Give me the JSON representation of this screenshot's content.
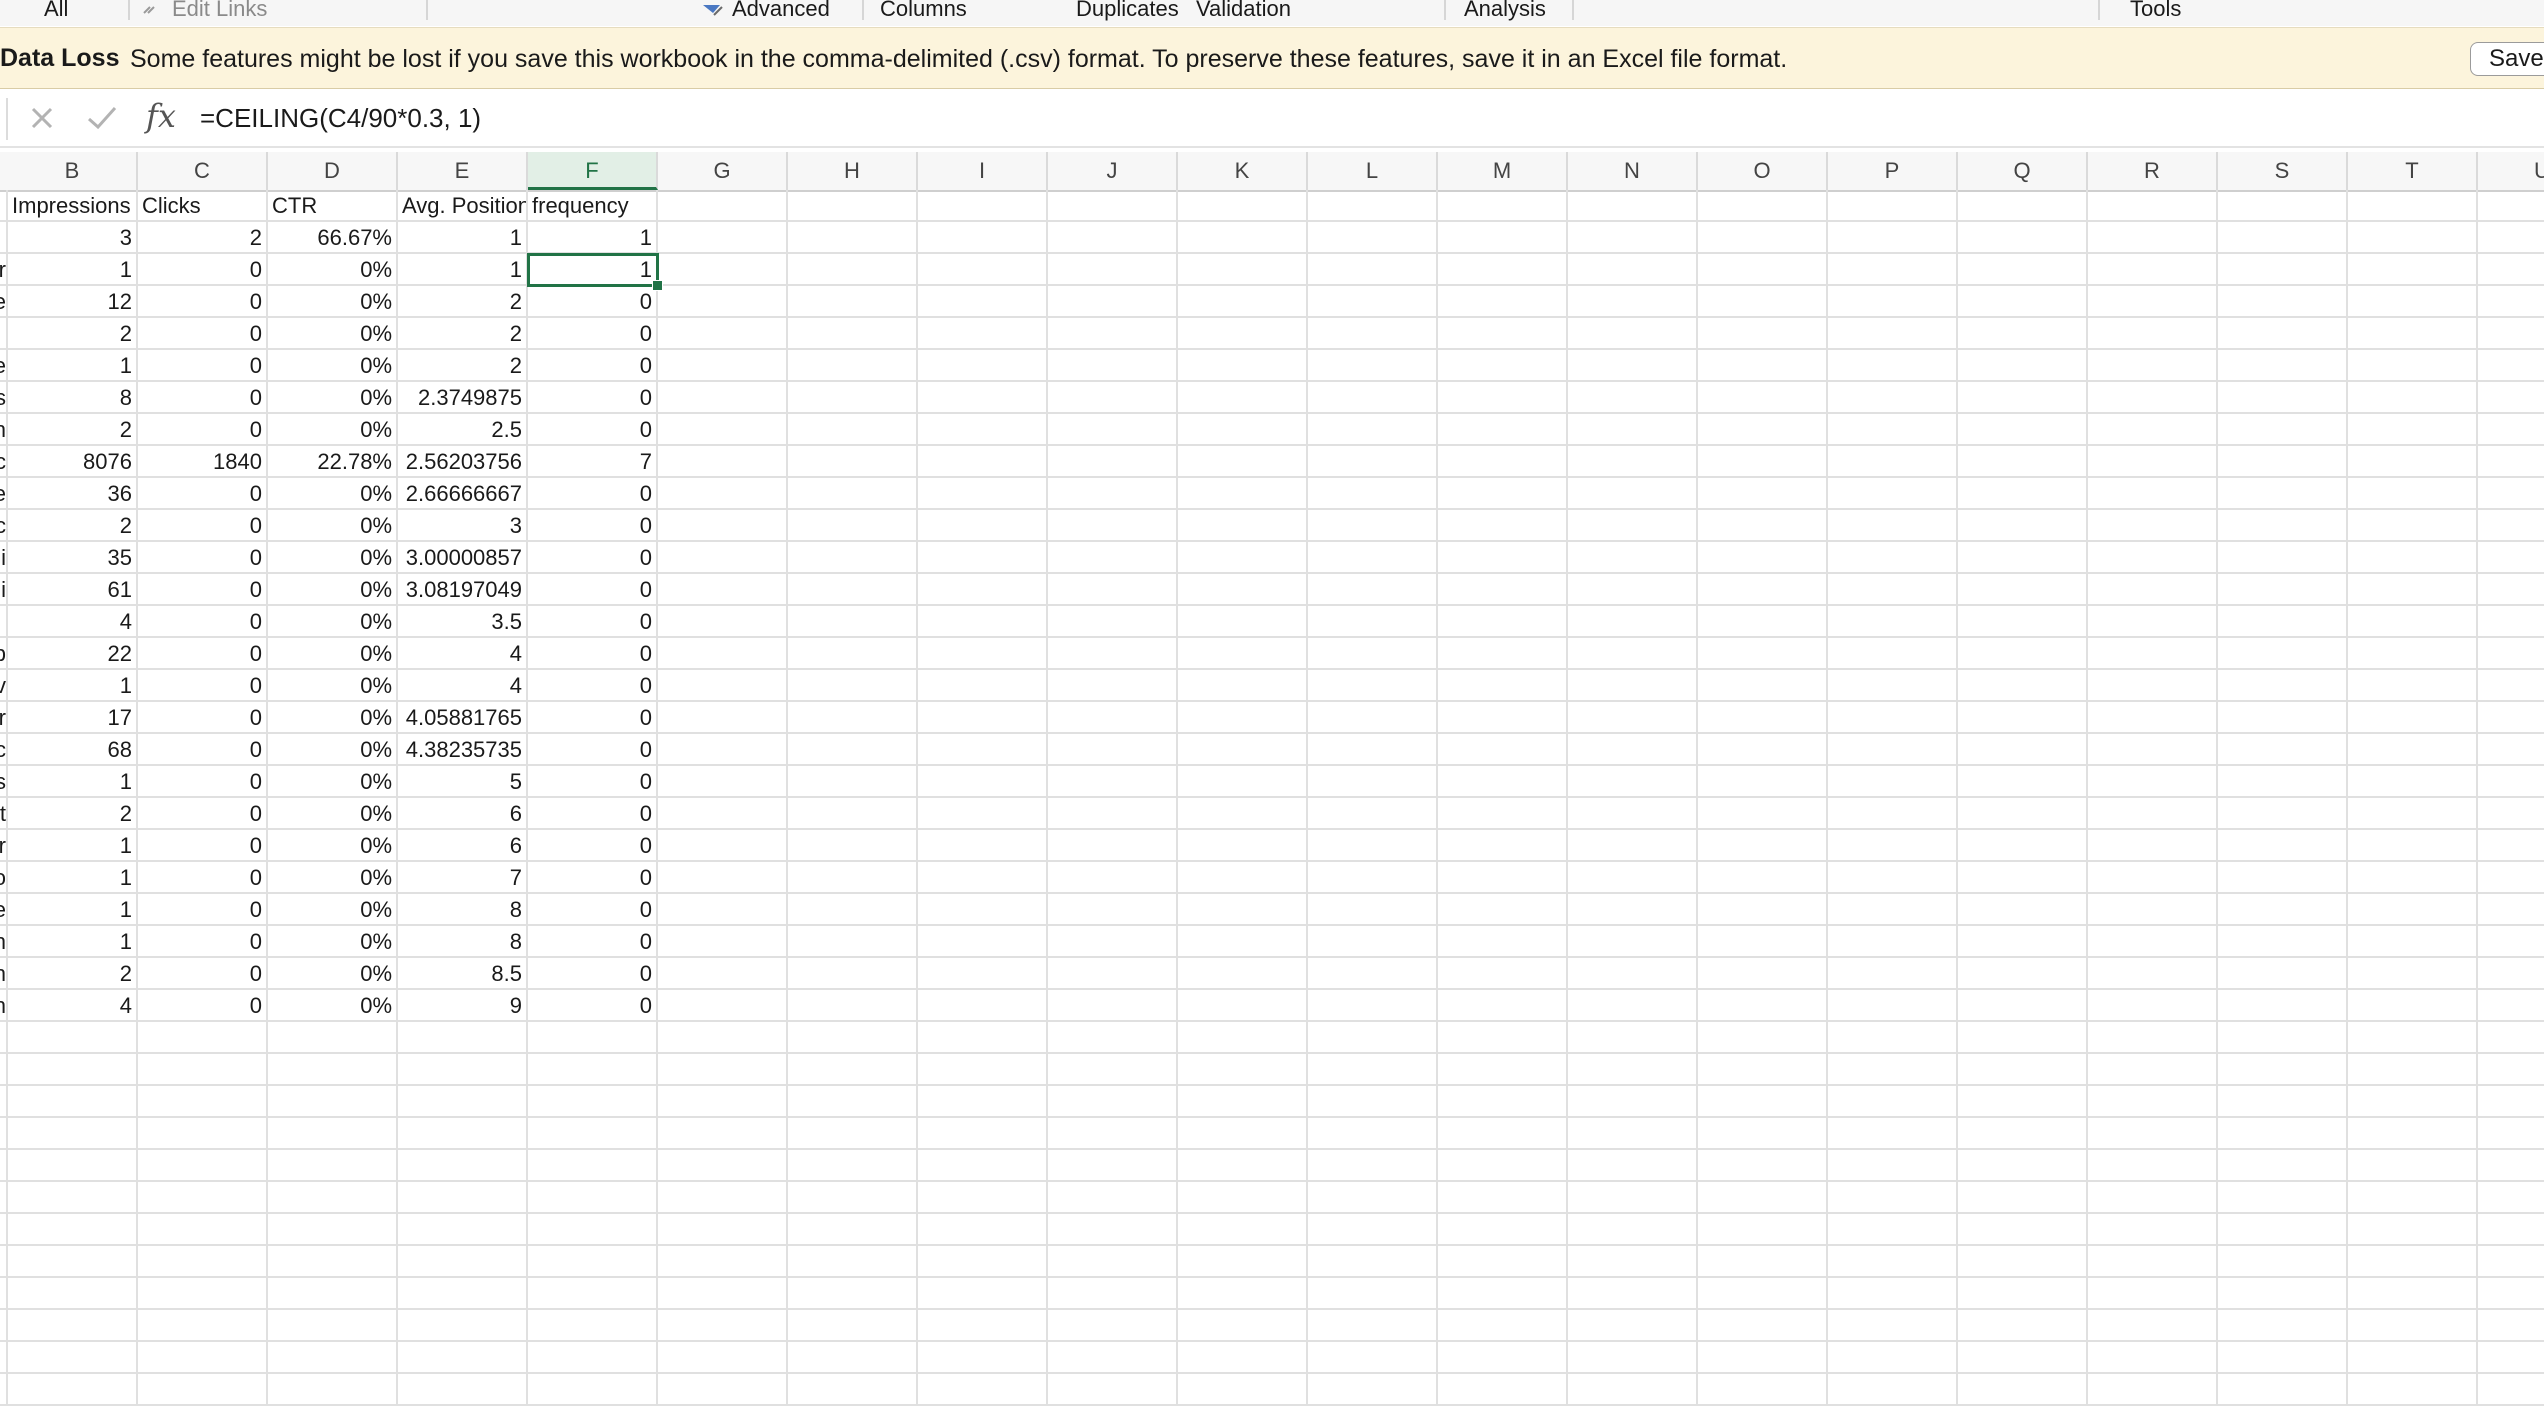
{
  "ribbon": {
    "items": [
      "All",
      "Edit Links",
      "Advanced",
      "Columns",
      "Duplicates",
      "Validation",
      "Analysis",
      "Tools"
    ]
  },
  "message_bar": {
    "title": "Data Loss",
    "text": "Some features might be lost if you save this workbook in the comma-delimited (.csv) format. To preserve these features, save it in an Excel file format.",
    "save_label": "Save",
    "bg_color": "#fcf4dc"
  },
  "formula_bar": {
    "fx_label": "fx",
    "formula": "=CEILING(C4/90*0.3, 1)",
    "cancel_icon": "close-icon",
    "confirm_icon": "checkmark-icon"
  },
  "sheet": {
    "accent_color": "#217346",
    "columns": [
      "B",
      "C",
      "D",
      "E",
      "F",
      "G",
      "H",
      "I",
      "J",
      "K",
      "L",
      "M",
      "N",
      "O",
      "P",
      "Q",
      "R",
      "S",
      "T",
      "U"
    ],
    "selected_column": "F",
    "active_cell": "F3",
    "headers": [
      "Impressions",
      "Clicks",
      "CTR",
      "Avg. Position",
      "frequency"
    ],
    "rows": [
      [
        "3",
        "2",
        "66.67%",
        "1",
        "1"
      ],
      [
        "1",
        "0",
        "0%",
        "1",
        "1"
      ],
      [
        "12",
        "0",
        "0%",
        "2",
        "0"
      ],
      [
        "2",
        "0",
        "0%",
        "2",
        "0"
      ],
      [
        "1",
        "0",
        "0%",
        "2",
        "0"
      ],
      [
        "8",
        "0",
        "0%",
        "2.3749875",
        "0"
      ],
      [
        "2",
        "0",
        "0%",
        "2.5",
        "0"
      ],
      [
        "8076",
        "1840",
        "22.78%",
        "2.56203756",
        "7"
      ],
      [
        "36",
        "0",
        "0%",
        "2.66666667",
        "0"
      ],
      [
        "2",
        "0",
        "0%",
        "3",
        "0"
      ],
      [
        "35",
        "0",
        "0%",
        "3.00000857",
        "0"
      ],
      [
        "61",
        "0",
        "0%",
        "3.08197049",
        "0"
      ],
      [
        "4",
        "0",
        "0%",
        "3.5",
        "0"
      ],
      [
        "22",
        "0",
        "0%",
        "4",
        "0"
      ],
      [
        "1",
        "0",
        "0%",
        "4",
        "0"
      ],
      [
        "17",
        "0",
        "0%",
        "4.05881765",
        "0"
      ],
      [
        "68",
        "0",
        "0%",
        "4.38235735",
        "0"
      ],
      [
        "1",
        "0",
        "0%",
        "5",
        "0"
      ],
      [
        "2",
        "0",
        "0%",
        "6",
        "0"
      ],
      [
        "1",
        "0",
        "0%",
        "6",
        "0"
      ],
      [
        "1",
        "0",
        "0%",
        "7",
        "0"
      ],
      [
        "1",
        "0",
        "0%",
        "8",
        "0"
      ],
      [
        "1",
        "0",
        "0%",
        "8",
        "0"
      ],
      [
        "2",
        "0",
        "0%",
        "8.5",
        "0"
      ],
      [
        "4",
        "0",
        "0%",
        "9",
        "0"
      ]
    ],
    "col_a_fragments": [
      "",
      "",
      "r",
      "e",
      "",
      "e",
      "s",
      "n",
      "c",
      "e",
      "c",
      "i",
      "i",
      "",
      "p",
      "v",
      "r",
      "c",
      "s",
      "t",
      "r",
      "o",
      "e",
      "n",
      "n",
      "n"
    ]
  }
}
